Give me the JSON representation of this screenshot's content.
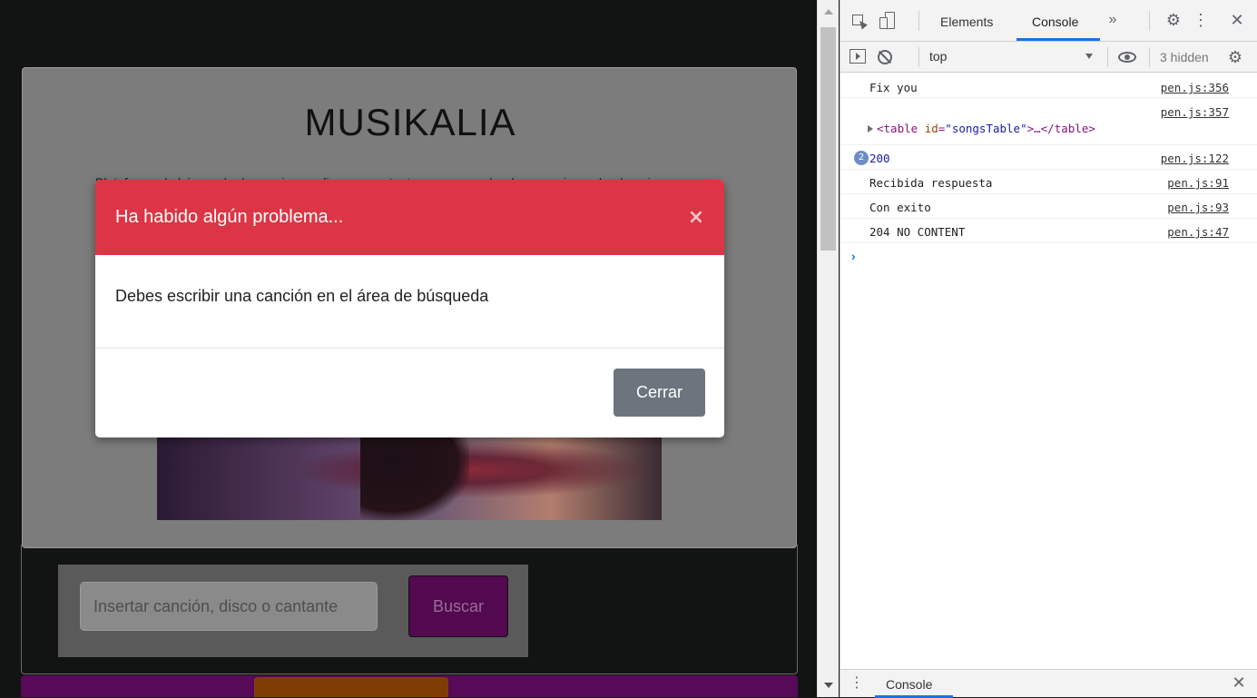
{
  "page": {
    "title": "MUSIKALIA",
    "subtitle": "Plataforma de búsqueda de canciones, discos y cantantes para escuchar lo que quieras donde quieras",
    "search": {
      "placeholder": "Insertar canción, disco o cantante",
      "button_label": "Buscar"
    }
  },
  "modal": {
    "title": "Ha habido algún problema...",
    "close_glyph": "×",
    "body": "Debes escribir una canción en el área de búsqueda",
    "button_label": "Cerrar",
    "header_color": "#dc3545"
  },
  "devtools": {
    "tabs": [
      {
        "label": "Elements"
      },
      {
        "label": "Console"
      }
    ],
    "more_glyph": "»",
    "settings_glyph": "⚙",
    "kebab_glyph": "⋮",
    "close_glyph": "✕",
    "context": "top",
    "hidden": "3 hidden",
    "log": [
      {
        "message": "Fix you",
        "source": "pen.js:356"
      },
      {
        "source": "pen.js:357",
        "table": {
          "open": "<",
          "tag": "table",
          "attr": "id",
          "eq": "=",
          "value": "\"songsTable\"",
          "close": ">…</",
          "tag2": "table",
          "end": ">"
        }
      },
      {
        "count": "2",
        "message": "200",
        "source": "pen.js:122"
      },
      {
        "message": "Recibida respuesta",
        "source": "pen.js:91"
      },
      {
        "message": "Con exito",
        "source": "pen.js:93"
      },
      {
        "message": "204 NO CONTENT",
        "source": "pen.js:47"
      }
    ],
    "prompt": "›",
    "drawer": {
      "menu_glyph": "⋮",
      "tab": "Console",
      "close_glyph": "✕"
    }
  }
}
